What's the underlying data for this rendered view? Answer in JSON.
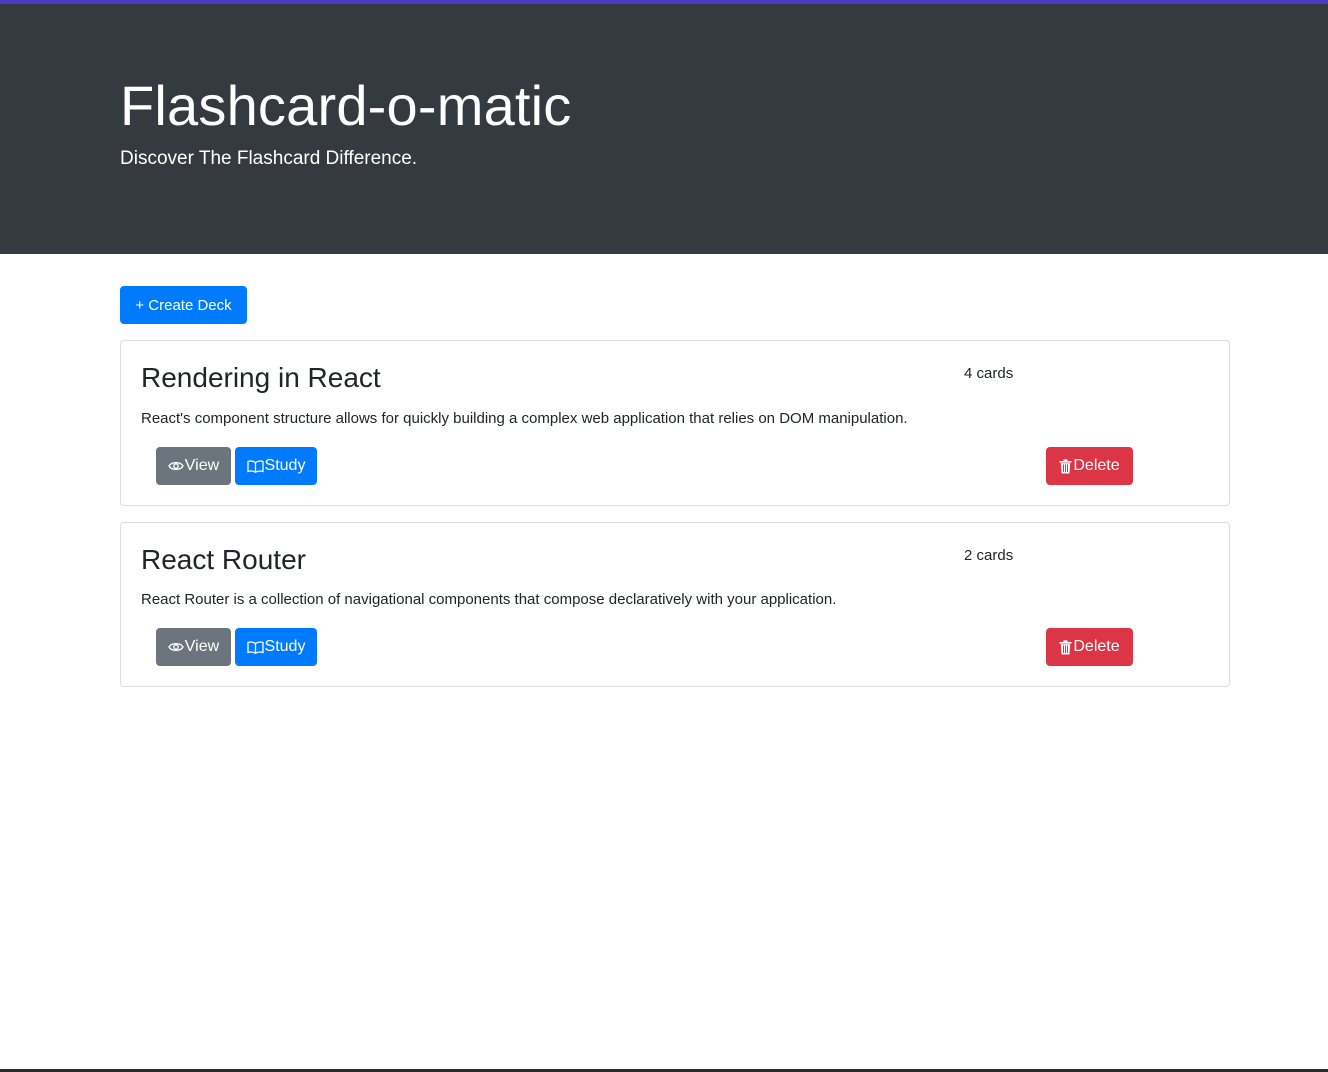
{
  "colors": {
    "accent_bar": "#4a3cc9",
    "header_bg": "#343a40",
    "primary": "#007bff",
    "secondary": "#6c757d",
    "danger": "#dc3545"
  },
  "header": {
    "title": "Flashcard-o-matic",
    "subtitle": "Discover The Flashcard Difference."
  },
  "toolbar": {
    "create_icon": "plus-icon",
    "create_label": "+ Create Deck"
  },
  "decks": [
    {
      "name": "Rendering in React",
      "card_count": "4 cards",
      "description": "React's component structure allows for quickly building a complex web application that relies on DOM manipulation.",
      "view_icon": "eye-icon",
      "view_label": "View",
      "study_icon": "book-icon",
      "study_label": "Study",
      "delete_icon": "trash-icon",
      "delete_label": "Delete"
    },
    {
      "name": "React Router",
      "card_count": "2 cards",
      "description": "React Router is a collection of navigational components that compose declaratively with your application.",
      "view_icon": "eye-icon",
      "view_label": "View",
      "study_icon": "book-icon",
      "study_label": "Study",
      "delete_icon": "trash-icon",
      "delete_label": "Delete"
    }
  ]
}
